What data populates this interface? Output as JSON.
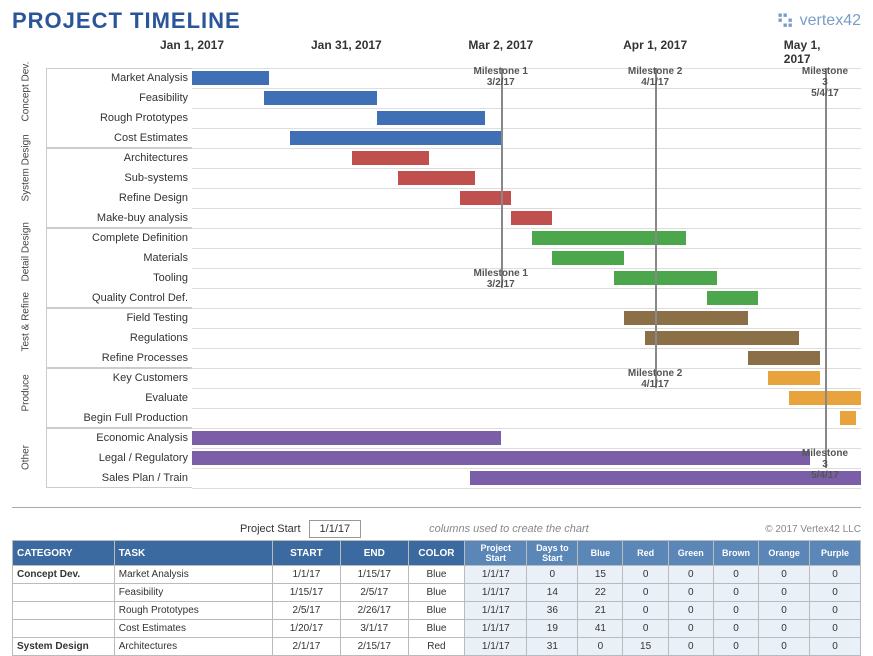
{
  "title": "PROJECT TIMELINE",
  "brand": "vertex42",
  "project_start_label": "Project Start",
  "project_start_value": "1/1/17",
  "columns_note": "columns used to create the chart",
  "copyright": "© 2017 Vertex42 LLC",
  "axis_dates": [
    "Jan 1, 2017",
    "Jan 31, 2017",
    "Mar 2, 2017",
    "Apr 1, 2017",
    "May 1, 2017"
  ],
  "milestones": [
    {
      "name": "Milestone 1",
      "date": "3/2/17",
      "top_row": 0,
      "bottom_row": 11
    },
    {
      "name": "Milestone 2",
      "date": "4/1/17",
      "top_row": 0,
      "bottom_row": 16
    },
    {
      "name": "Milestone 3",
      "date": "5/4/17",
      "top_row": 0,
      "bottom_row": 20
    }
  ],
  "colors": {
    "Blue": "#3f6fb5",
    "Red": "#c0504d",
    "Green": "#4ca64c",
    "Brown": "#8b6f47",
    "Orange": "#e8a33d",
    "Purple": "#7a5fa8"
  },
  "table_headers": [
    "CATEGORY",
    "TASK",
    "START",
    "END",
    "COLOR"
  ],
  "table_sub_headers": [
    "Project Start",
    "Days to Start",
    "Blue",
    "Red",
    "Green",
    "Brown",
    "Orange",
    "Purple"
  ],
  "table_rows": [
    {
      "cat": "Concept Dev.",
      "task": "Market Analysis",
      "start": "1/1/17",
      "end": "1/15/17",
      "color": "Blue",
      "ps": "1/1/17",
      "dts": 0,
      "v": [
        15,
        0,
        0,
        0,
        0,
        0
      ]
    },
    {
      "cat": "",
      "task": "Feasibility",
      "start": "1/15/17",
      "end": "2/5/17",
      "color": "Blue",
      "ps": "1/1/17",
      "dts": 14,
      "v": [
        22,
        0,
        0,
        0,
        0,
        0
      ]
    },
    {
      "cat": "",
      "task": "Rough Prototypes",
      "start": "2/5/17",
      "end": "2/26/17",
      "color": "Blue",
      "ps": "1/1/17",
      "dts": 36,
      "v": [
        21,
        0,
        0,
        0,
        0,
        0
      ]
    },
    {
      "cat": "",
      "task": "Cost Estimates",
      "start": "1/20/17",
      "end": "3/1/17",
      "color": "Blue",
      "ps": "1/1/17",
      "dts": 19,
      "v": [
        41,
        0,
        0,
        0,
        0,
        0
      ]
    },
    {
      "cat": "System Design",
      "task": "Architectures",
      "start": "2/1/17",
      "end": "2/15/17",
      "color": "Red",
      "ps": "1/1/17",
      "dts": 31,
      "v": [
        0,
        15,
        0,
        0,
        0,
        0
      ]
    }
  ],
  "chart_data": {
    "type": "gantt",
    "x_start": "2017-01-01",
    "x_end": "2017-05-10",
    "groups": [
      {
        "name": "Concept Dev.",
        "tasks": [
          {
            "label": "Market Analysis",
            "start": 0,
            "dur": 15,
            "color": "Blue"
          },
          {
            "label": "Feasibility",
            "start": 14,
            "dur": 22,
            "color": "Blue"
          },
          {
            "label": "Rough Prototypes",
            "start": 36,
            "dur": 21,
            "color": "Blue"
          },
          {
            "label": "Cost Estimates",
            "start": 19,
            "dur": 41,
            "color": "Blue"
          }
        ]
      },
      {
        "name": "System Design",
        "tasks": [
          {
            "label": "Architectures",
            "start": 31,
            "dur": 15,
            "color": "Red"
          },
          {
            "label": "Sub-systems",
            "start": 40,
            "dur": 15,
            "color": "Red"
          },
          {
            "label": "Refine Design",
            "start": 52,
            "dur": 10,
            "color": "Red"
          },
          {
            "label": "Make-buy analysis",
            "start": 62,
            "dur": 8,
            "color": "Red"
          }
        ]
      },
      {
        "name": "Detail Design",
        "tasks": [
          {
            "label": "Complete Definition",
            "start": 66,
            "dur": 30,
            "color": "Green"
          },
          {
            "label": "Materials",
            "start": 70,
            "dur": 14,
            "color": "Green"
          },
          {
            "label": "Tooling",
            "start": 82,
            "dur": 20,
            "color": "Green"
          },
          {
            "label": "Quality Control Def.",
            "start": 100,
            "dur": 10,
            "color": "Green"
          }
        ]
      },
      {
        "name": "Test & Refine",
        "tasks": [
          {
            "label": "Field Testing",
            "start": 84,
            "dur": 24,
            "color": "Brown"
          },
          {
            "label": "Regulations",
            "start": 88,
            "dur": 30,
            "color": "Brown"
          },
          {
            "label": "Refine Processes",
            "start": 108,
            "dur": 14,
            "color": "Brown"
          }
        ]
      },
      {
        "name": "Produce",
        "tasks": [
          {
            "label": "Key Customers",
            "start": 112,
            "dur": 10,
            "color": "Orange"
          },
          {
            "label": "Evaluate",
            "start": 116,
            "dur": 14,
            "color": "Orange"
          },
          {
            "label": "Begin Full Production",
            "start": 126,
            "dur": 3,
            "color": "Orange"
          }
        ]
      },
      {
        "name": "Other",
        "tasks": [
          {
            "label": "Economic Analysis",
            "start": 0,
            "dur": 60,
            "color": "Purple"
          },
          {
            "label": "Legal / Regulatory",
            "start": 0,
            "dur": 120,
            "color": "Purple"
          },
          {
            "label": "Sales Plan / Train",
            "start": 54,
            "dur": 76,
            "color": "Purple"
          }
        ]
      }
    ],
    "milestones": [
      {
        "name": "Milestone 1",
        "day": 60,
        "date": "3/2/17"
      },
      {
        "name": "Milestone 2",
        "day": 90,
        "date": "4/1/17"
      },
      {
        "name": "Milestone 3",
        "day": 123,
        "date": "5/4/17"
      }
    ]
  }
}
